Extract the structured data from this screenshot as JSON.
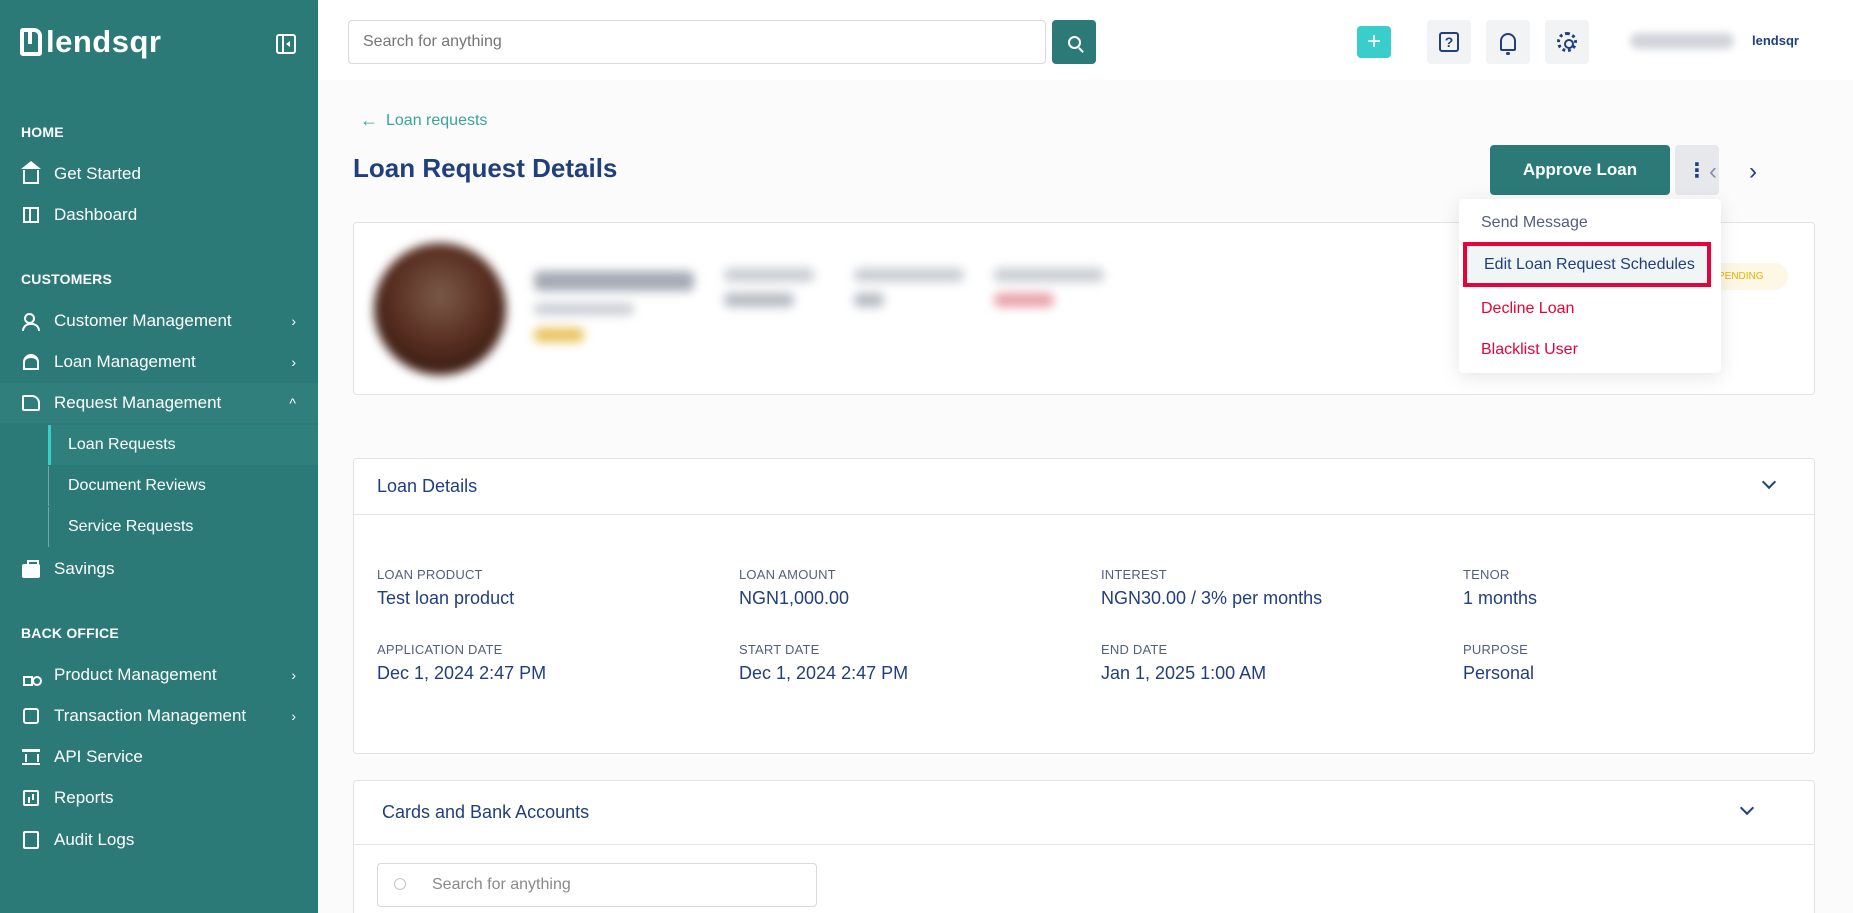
{
  "brand": {
    "name": "lendsqr",
    "small_name": "lendsqr"
  },
  "search": {
    "placeholder": "Search for anything"
  },
  "sidebar": {
    "sections": [
      {
        "title": "HOME"
      },
      {
        "title": "CUSTOMERS"
      },
      {
        "title": "BACK OFFICE"
      }
    ],
    "items": {
      "get_started": "Get Started",
      "dashboard": "Dashboard",
      "customer_management": "Customer Management",
      "loan_management": "Loan Management",
      "request_management": "Request Management",
      "loan_requests": "Loan Requests",
      "document_reviews": "Document Reviews",
      "service_requests": "Service Requests",
      "savings": "Savings",
      "product_management": "Product Management",
      "transaction_management": "Transaction Management",
      "api_service": "API Service",
      "reports": "Reports",
      "audit_logs": "Audit Logs"
    }
  },
  "page": {
    "back_label": "Loan requests",
    "title": "Loan Request Details",
    "approve_label": "Approve Loan",
    "status": "PENDING"
  },
  "menu": {
    "send_message": "Send Message",
    "edit_schedules": "Edit Loan Request Schedules",
    "decline_loan": "Decline Loan",
    "blacklist_user": "Blacklist User"
  },
  "loan_details": {
    "title": "Loan Details",
    "fields": [
      {
        "label": "LOAN PRODUCT",
        "value": "Test loan product"
      },
      {
        "label": "LOAN AMOUNT",
        "value": "NGN1,000.00"
      },
      {
        "label": "INTEREST",
        "value": "NGN30.00 / 3% per months"
      },
      {
        "label": "TENOR",
        "value": "1 months"
      },
      {
        "label": "APPLICATION DATE",
        "value": "Dec 1, 2024 2:47 PM"
      },
      {
        "label": "START DATE",
        "value": "Dec 1, 2024 2:47 PM"
      },
      {
        "label": "END DATE",
        "value": "Jan 1, 2025 1:00 AM"
      },
      {
        "label": "PURPOSE",
        "value": "Personal"
      }
    ]
  },
  "cards": {
    "title": "Cards and Bank Accounts",
    "search_placeholder": "Search for anything"
  },
  "colors": {
    "primary": "#2b7a78",
    "accent": "#39cdcc",
    "text": "#213f7d",
    "danger": "#e4033b"
  }
}
